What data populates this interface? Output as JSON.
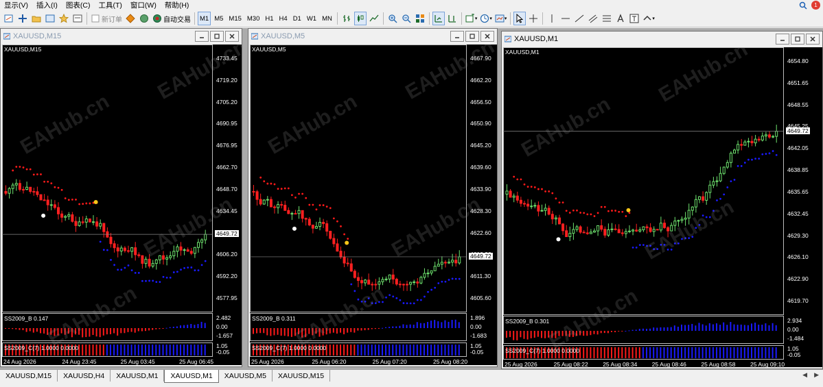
{
  "menu": [
    {
      "label": "显示(V)"
    },
    {
      "label": "插入(I)"
    },
    {
      "label": "图表(C)"
    },
    {
      "label": "工具(T)"
    },
    {
      "label": "窗口(W)"
    },
    {
      "label": "帮助(H)"
    }
  ],
  "menu_badge": "1",
  "toolbar": {
    "new_order": "新订单",
    "auto_trade": "自动交易",
    "periods": [
      "M1",
      "M5",
      "M15",
      "M30",
      "H1",
      "H4",
      "D1",
      "W1",
      "MN"
    ]
  },
  "colors": {
    "bull": "#6ee26e",
    "bear": "#ff2020",
    "trend_up": "#1a1aff",
    "trend_down": "#ff1a1a",
    "chart_bg": "#000000",
    "workspace": "#ababab"
  },
  "watermark": "EAHub.cn",
  "windows": [
    {
      "title": "XAUUSD,M15",
      "symbol_label": "XAUUSD,M15",
      "active": false,
      "price_ticks": [
        "4733.45",
        "4719.20",
        "4705.20",
        "4690.95",
        "4676.95",
        "4662.70",
        "4648.70",
        "4634.45",
        "4620.45",
        "4606.20",
        "4592.20",
        "4577.95"
      ],
      "current_price": "4649.72",
      "ind1_label": "SS2009_B 0.147",
      "ind1_ticks": [
        "2.482",
        "0.00",
        "-1.657"
      ],
      "ind2_label": "SS2009_C(7) 1.0000 0.0000",
      "ind2_ticks": [
        "1.05",
        "-0.05"
      ],
      "time_ticks": [
        "24 Aug 2026",
        "24 Aug 23:45",
        "25 Aug 03:45",
        "25 Aug 06:45"
      ]
    },
    {
      "title": "XAUUSD,M5",
      "symbol_label": "XAUUSD,M5",
      "active": false,
      "price_ticks": [
        "4667.90",
        "4662.20",
        "4656.50",
        "4650.90",
        "4645.20",
        "4639.60",
        "4633.90",
        "4628.30",
        "4622.60",
        "4616.90",
        "4611.30",
        "4605.60"
      ],
      "current_price": "4649.72",
      "ind1_label": "SS2009_B 0.311",
      "ind1_ticks": [
        "1.896",
        "0.00",
        "-1.683"
      ],
      "ind2_label": "SS2009_C(7) 1.0000 0.0000",
      "ind2_ticks": [
        "1.05",
        "-0.05"
      ],
      "time_ticks": [
        "25 Aug 2026",
        "25 Aug 06:20",
        "25 Aug 07:20",
        "25 Aug 08:20"
      ]
    },
    {
      "title": "XAUUSD,M1",
      "symbol_label": "XAUUSD,M1",
      "active": true,
      "price_ticks": [
        "4654.80",
        "4651.65",
        "4648.55",
        "4645.25",
        "4642.05",
        "4638.85",
        "4635.65",
        "4632.45",
        "4629.30",
        "4626.10",
        "4622.90",
        "4619.70"
      ],
      "current_price": "4649.72",
      "ind1_label": "SS2009_B 0.301",
      "ind1_ticks": [
        "2.934",
        "0.00",
        "-1.484"
      ],
      "ind2_label": "SS2009_C(7) 1.0000 0.0000",
      "ind2_ticks": [
        "1.05",
        "-0.05"
      ],
      "time_ticks": [
        "25 Aug 2026",
        "25 Aug 08:22",
        "25 Aug 08:34",
        "25 Aug 08:46",
        "25 Aug 08:58",
        "25 Aug 09:10"
      ]
    }
  ],
  "tabs": [
    {
      "label": "XAUUSD,M15",
      "active": false
    },
    {
      "label": "XAUUSD,H4",
      "active": false
    },
    {
      "label": "XAUUSD,M1",
      "active": false
    },
    {
      "label": "XAUUSD,M1",
      "active": true
    },
    {
      "label": "XAUUSD,M5",
      "active": false
    },
    {
      "label": "XAUUSD,M15",
      "active": false
    }
  ]
}
